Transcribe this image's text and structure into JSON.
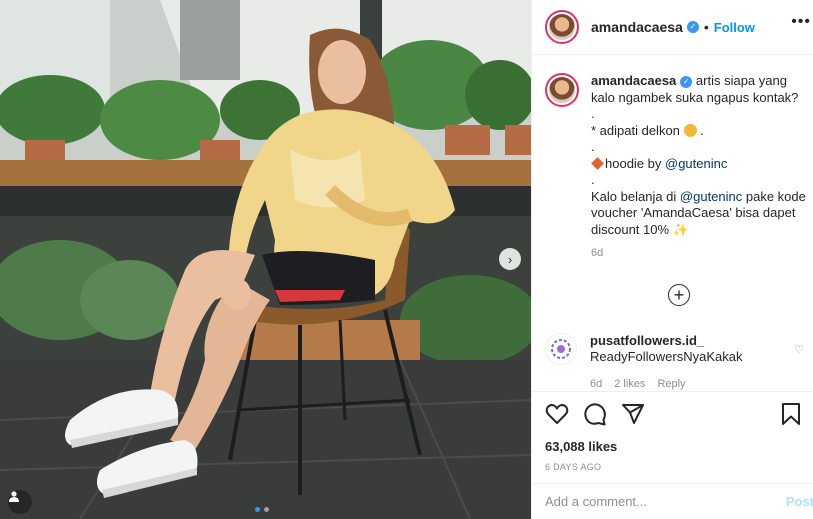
{
  "post": {
    "username": "amandacaesa",
    "verified_icon": "verified-badge-icon",
    "separator": "•",
    "follow_label": "Follow",
    "more_label": "•••"
  },
  "caption": {
    "username": "amandacaesa",
    "line1": "artis siapa yang kalo ngambek suka ngapus kontak?",
    "dot1": ".",
    "line2": "* adipati delkon",
    "line2_suffix": " .",
    "dot2": ".",
    "hoodie_prefix": "hoodie by ",
    "hoodie_mention": "@guteninc",
    "dot3": ".",
    "promo_prefix": "Kalo belanja di ",
    "promo_mention": "@guteninc",
    "promo_suffix": " pake kode voucher 'AmandaCaesa' bisa dapet discount 10% ",
    "time": "6d"
  },
  "comment": {
    "username": "pusatfollowers.id_",
    "text": "ReadyFollowersNyaKakak",
    "time": "6d",
    "likes": "2 likes",
    "reply": "Reply"
  },
  "load_more_icon": "plus-circle-icon",
  "actions": {
    "likes": "63,088 likes",
    "date": "6 DAYS AGO"
  },
  "add_comment": {
    "placeholder": "Add a comment...",
    "post_label": "Post"
  },
  "carousel": {
    "slide_count": 2,
    "active_index": 0
  },
  "colors": {
    "accent": "#0095f6",
    "verified": "#3897f0",
    "post_disabled": "#b2dffc"
  }
}
